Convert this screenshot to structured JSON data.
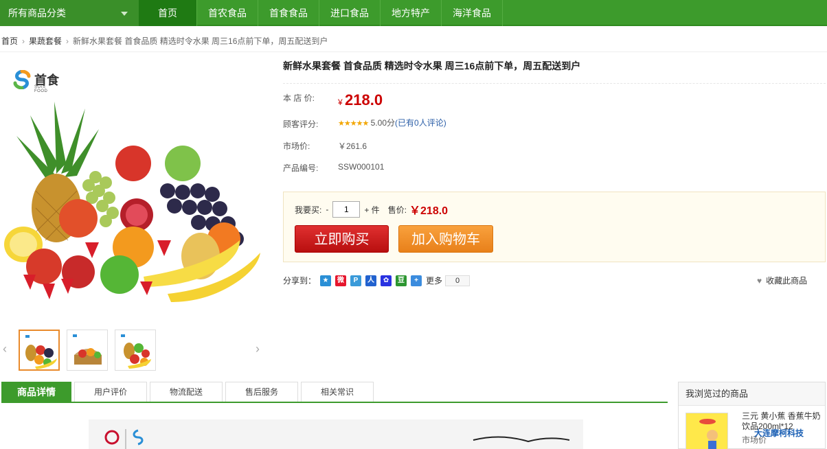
{
  "nav": {
    "all_categories": "所有商品分类",
    "items": [
      "首页",
      "首农食品",
      "首食食品",
      "进口食品",
      "地方特产",
      "海洋食品"
    ]
  },
  "breadcrumb": [
    "首页",
    "果蔬套餐",
    "新鲜水果套餐 首食品质 精选时令水果 周三16点前下单，周五配送到户"
  ],
  "brand": {
    "name": "首食",
    "sub": "SOIS FOOD"
  },
  "product": {
    "title": "新鲜水果套餐 首食品质 精选时令水果 周三16点前下单，周五配送到户",
    "store_price_label": "本 店 价:",
    "currency": "¥",
    "store_price": "218.0",
    "rating_label": "顾客评分:",
    "stars": "★★★★★",
    "rating_score": "5.00分",
    "rating_paren_open": "(",
    "rating_link": "已有0人评论",
    "rating_paren_close": ")",
    "market_price_label": "市场价:",
    "market_price": "￥261.6",
    "sku_label": "产品编号:",
    "sku": "SSW000101"
  },
  "buy": {
    "qty_label": "我要买:",
    "minus": "-",
    "qty": "1",
    "plus_unit": "+ 件",
    "sell_label": "售价:",
    "sell_price": "￥218.0",
    "buy_now": "立即购买",
    "add_cart": "加入购物车"
  },
  "share": {
    "label": "分享到：",
    "more": "更多",
    "count": "0",
    "favorite": "收藏此商品"
  },
  "thumbs": {
    "prev": "‹",
    "next": "›"
  },
  "tabs": [
    "商品详情",
    "用户评价",
    "物流配送",
    "售后服务",
    "相关常识"
  ],
  "viewed": {
    "title": "我浏览过的商品",
    "item_name": "三元 黄小蕉 香蕉牛奶饮品200ml*12",
    "item_market": "市场价"
  },
  "watermark": "大连摩柯科技",
  "colors": {
    "nav_green": "#3d9b2c",
    "price_red": "#cc0000",
    "buy_red": "#c81818",
    "cart_orange": "#f0902a"
  }
}
